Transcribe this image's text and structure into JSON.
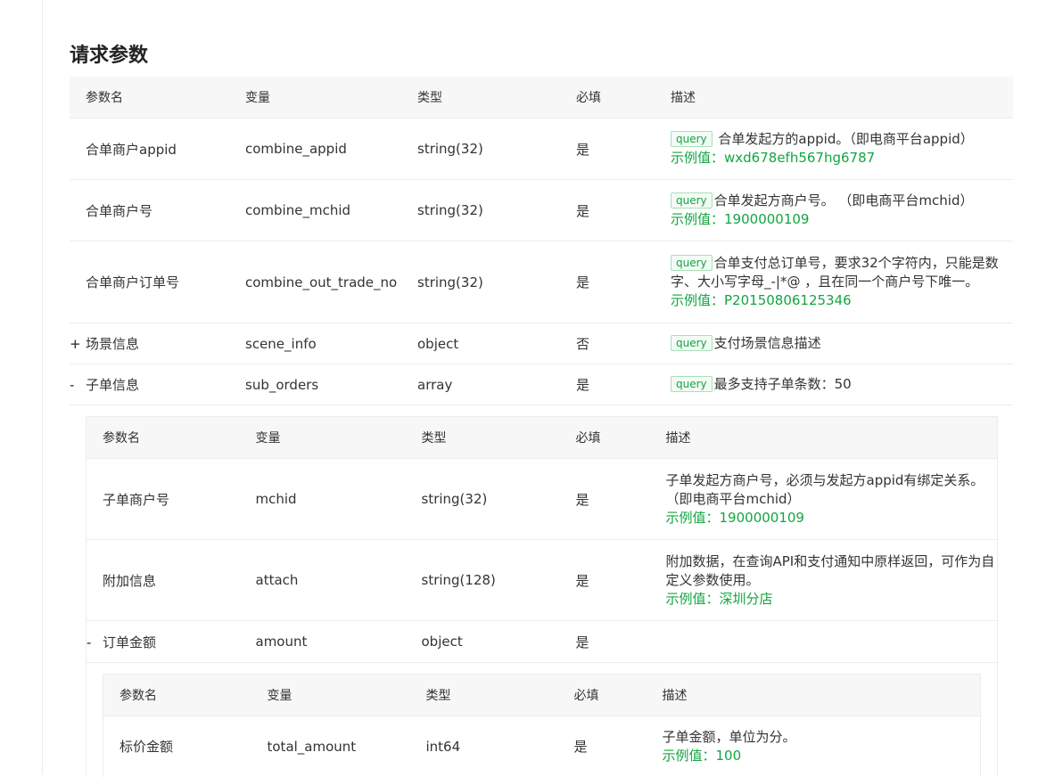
{
  "title": "请求参数",
  "columns": [
    "参数名",
    "变量",
    "类型",
    "必填",
    "描述"
  ],
  "tag_label": "query",
  "example_prefix": "示例值：",
  "expanded_icon": "-",
  "collapsed_icon": "+",
  "rows": [
    {
      "name": "合单商户appid",
      "var": "combine_appid",
      "type": "string(32)",
      "required": "是",
      "desc": "合单发起方的appid。（即电商平台appid）",
      "example": "wxd678efh567hg6787"
    },
    {
      "name": "合单商户号",
      "var": "combine_mchid",
      "type": "string(32)",
      "required": "是",
      "desc": "合单发起方商户号。 （即电商平台mchid）",
      "example": "1900000109"
    },
    {
      "name": "合单商户订单号",
      "var": "combine_out_trade_no",
      "type": "string(32)",
      "required": "是",
      "desc": "合单支付总订单号，要求32个字符内，只能是数字、大小写字母_-|*@ ，且在同一个商户号下唯一。",
      "example": "P20150806125346"
    },
    {
      "name": "场景信息",
      "var": "scene_info",
      "type": "object",
      "required": "否",
      "desc": "支付场景信息描述"
    },
    {
      "name": "子单信息",
      "var": "sub_orders",
      "type": "array",
      "required": "是",
      "desc": "最多支持子单条数：50"
    }
  ],
  "sub_rows": [
    {
      "name": "子单商户号",
      "var": "mchid",
      "type": "string(32)",
      "required": "是",
      "desc": "子单发起方商户号，必须与发起方appid有绑定关系。（即电商平台mchid）",
      "example": "1900000109"
    },
    {
      "name": "附加信息",
      "var": "attach",
      "type": "string(128)",
      "required": "是",
      "desc": "附加数据，在查询API和支付通知中原样返回，可作为自定义参数使用。",
      "example": "深圳分店"
    },
    {
      "name": "订单金额",
      "var": "amount",
      "type": "object",
      "required": "是"
    }
  ],
  "amount_rows": [
    {
      "name": "标价金额",
      "var": "total_amount",
      "type": "int64",
      "required": "是",
      "desc": "子单金额，单位为分。",
      "example": "100"
    }
  ]
}
